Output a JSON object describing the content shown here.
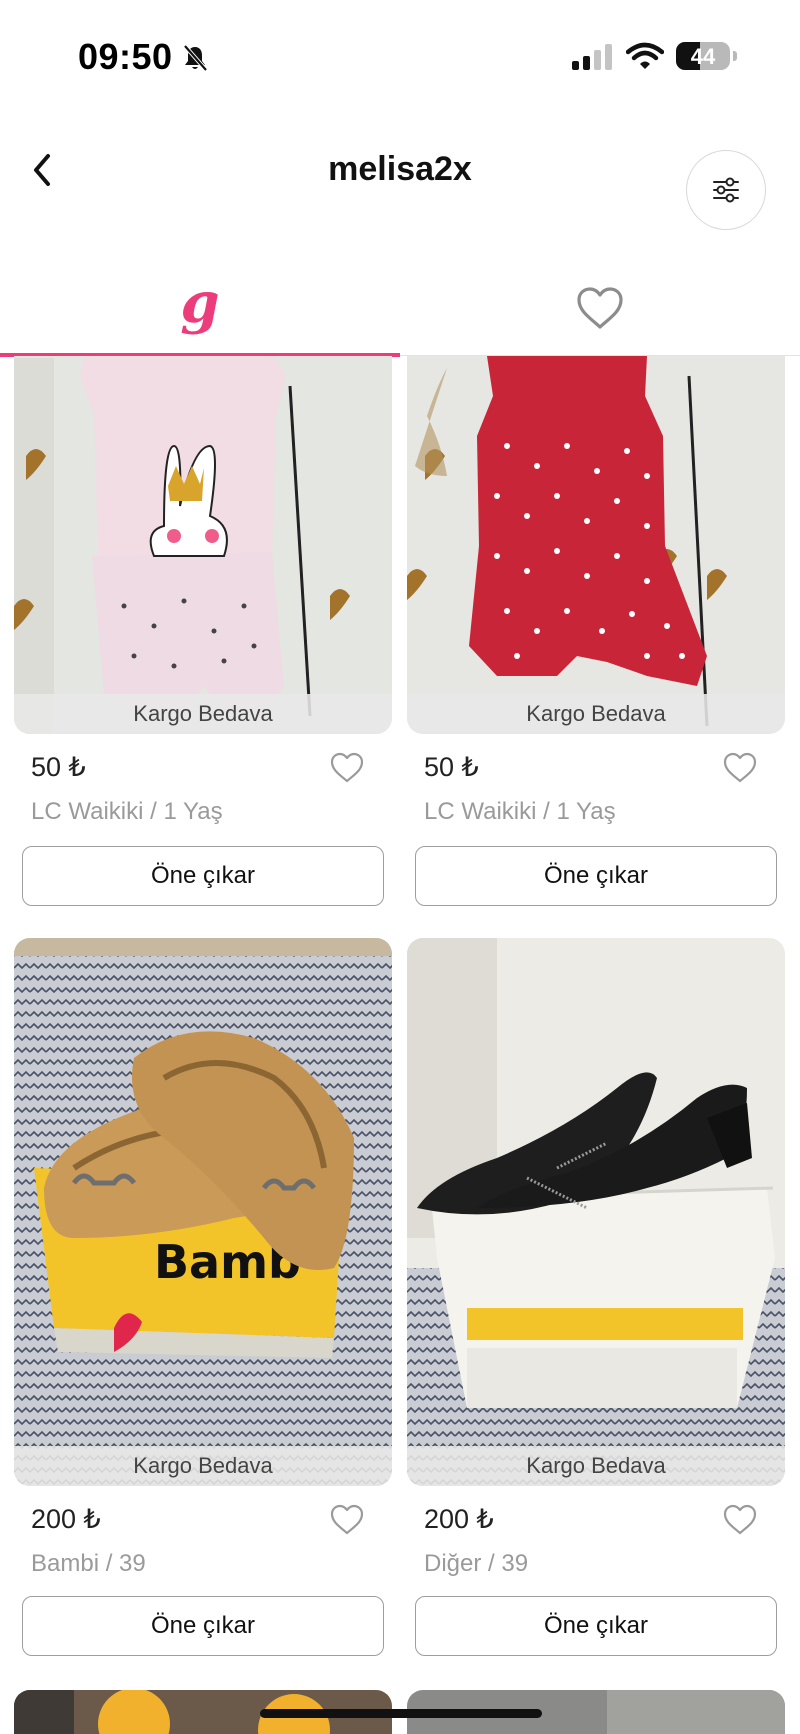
{
  "status_bar": {
    "time": "09:50",
    "battery": "44"
  },
  "header": {
    "title": "melisa2x"
  },
  "tabs": [
    {
      "name": "listings",
      "glyph": "g"
    },
    {
      "name": "favorites",
      "icon": "heart-icon"
    }
  ],
  "colors": {
    "accent": "#ec3c7c"
  },
  "products": [
    {
      "badge": "Kargo Bedava",
      "price": "50 ₺",
      "meta": "LC Waikiki / 1 Yaş",
      "button": "Öne çıkar"
    },
    {
      "badge": "Kargo Bedava",
      "price": "50 ₺",
      "meta": "LC Waikiki / 1 Yaş",
      "button": "Öne çıkar"
    },
    {
      "badge": "Kargo Bedava",
      "price": "200 ₺",
      "meta": "Bambi / 39",
      "button": "Öne çıkar"
    },
    {
      "badge": "Kargo Bedava",
      "price": "200 ₺",
      "meta": "Diğer / 39",
      "button": "Öne çıkar"
    }
  ]
}
